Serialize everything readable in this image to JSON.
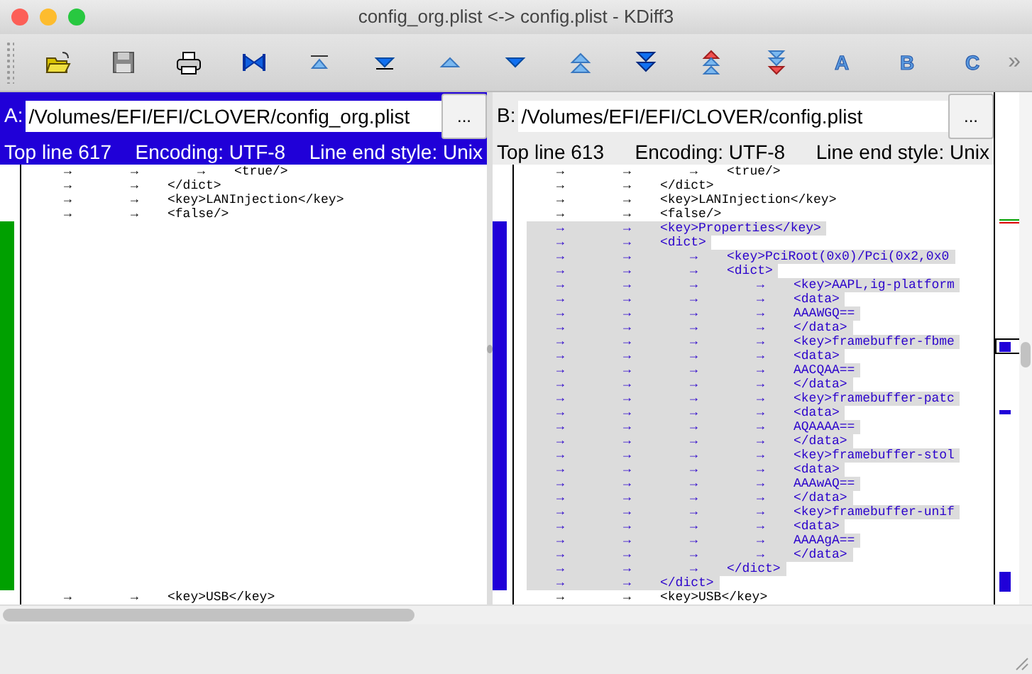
{
  "window": {
    "title": "config_org.plist <-> config.plist - KDiff3"
  },
  "toolbar": {
    "letters": [
      "A",
      "B",
      "C"
    ],
    "overflow": "»"
  },
  "panes": [
    {
      "label": "A:",
      "path": "/Volumes/EFI/EFI/CLOVER/config_org.plist",
      "browse": "...",
      "active": true,
      "top_line": "Top line 617",
      "encoding": "Encoding: UTF-8",
      "line_end": "Line end style: Unix",
      "lines": [
        {
          "kind": "same",
          "tabs": [
            "→",
            "→",
            "→"
          ],
          "text": "<true/>"
        },
        {
          "kind": "same",
          "tabs": [
            "→",
            "→"
          ],
          "text": "</dict>"
        },
        {
          "kind": "same",
          "tabs": [
            "→",
            "→"
          ],
          "text": "<key>LANInjection</key>"
        },
        {
          "kind": "same",
          "tabs": [
            "→",
            "→"
          ],
          "text": "<false/>"
        },
        {
          "kind": "blank"
        },
        {
          "kind": "blank"
        },
        {
          "kind": "blank"
        },
        {
          "kind": "blank"
        },
        {
          "kind": "blank"
        },
        {
          "kind": "blank"
        },
        {
          "kind": "blank"
        },
        {
          "kind": "blank"
        },
        {
          "kind": "blank"
        },
        {
          "kind": "blank"
        },
        {
          "kind": "blank"
        },
        {
          "kind": "blank"
        },
        {
          "kind": "blank"
        },
        {
          "kind": "blank"
        },
        {
          "kind": "blank"
        },
        {
          "kind": "blank"
        },
        {
          "kind": "blank"
        },
        {
          "kind": "blank"
        },
        {
          "kind": "blank"
        },
        {
          "kind": "blank"
        },
        {
          "kind": "blank"
        },
        {
          "kind": "blank"
        },
        {
          "kind": "blank"
        },
        {
          "kind": "blank"
        },
        {
          "kind": "blank"
        },
        {
          "kind": "blank"
        },
        {
          "kind": "same",
          "tabs": [
            "→",
            "→"
          ],
          "text": "<key>USB</key>"
        }
      ]
    },
    {
      "label": "B:",
      "path": "/Volumes/EFI/EFI/CLOVER/config.plist",
      "browse": "...",
      "active": false,
      "top_line": "Top line 613",
      "encoding": "Encoding: UTF-8",
      "line_end": "Line end style: Unix",
      "lines": [
        {
          "kind": "same",
          "tabs": [
            "→",
            "→",
            "→"
          ],
          "text": "<true/>"
        },
        {
          "kind": "same",
          "tabs": [
            "→",
            "→"
          ],
          "text": "</dict>"
        },
        {
          "kind": "same",
          "tabs": [
            "→",
            "→"
          ],
          "text": "<key>LANInjection</key>"
        },
        {
          "kind": "same",
          "tabs": [
            "→",
            "→"
          ],
          "text": "<false/>"
        },
        {
          "kind": "added",
          "tabs": [
            "→",
            "→"
          ],
          "text": "<key>Properties</key>"
        },
        {
          "kind": "added",
          "tabs": [
            "→",
            "→"
          ],
          "text": "<dict>"
        },
        {
          "kind": "added",
          "tabs": [
            "→",
            "→",
            "→"
          ],
          "text": "<key>PciRoot(0x0)/Pci(0x2,0x0"
        },
        {
          "kind": "added",
          "tabs": [
            "→",
            "→",
            "→"
          ],
          "text": "<dict>"
        },
        {
          "kind": "added",
          "tabs": [
            "→",
            "→",
            "→",
            "→"
          ],
          "text": "<key>AAPL,ig-platform"
        },
        {
          "kind": "added",
          "tabs": [
            "→",
            "→",
            "→",
            "→"
          ],
          "text": "<data>"
        },
        {
          "kind": "added",
          "tabs": [
            "→",
            "→",
            "→",
            "→"
          ],
          "text": "AAAWGQ=="
        },
        {
          "kind": "added",
          "tabs": [
            "→",
            "→",
            "→",
            "→"
          ],
          "text": "</data>"
        },
        {
          "kind": "added",
          "tabs": [
            "→",
            "→",
            "→",
            "→"
          ],
          "text": "<key>framebuffer-fbme"
        },
        {
          "kind": "added",
          "tabs": [
            "→",
            "→",
            "→",
            "→"
          ],
          "text": "<data>"
        },
        {
          "kind": "added",
          "tabs": [
            "→",
            "→",
            "→",
            "→"
          ],
          "text": "AACQAA=="
        },
        {
          "kind": "added",
          "tabs": [
            "→",
            "→",
            "→",
            "→"
          ],
          "text": "</data>"
        },
        {
          "kind": "added",
          "tabs": [
            "→",
            "→",
            "→",
            "→"
          ],
          "text": "<key>framebuffer-patc"
        },
        {
          "kind": "added",
          "tabs": [
            "→",
            "→",
            "→",
            "→"
          ],
          "text": "<data>"
        },
        {
          "kind": "added",
          "tabs": [
            "→",
            "→",
            "→",
            "→"
          ],
          "text": "AQAAAA=="
        },
        {
          "kind": "added",
          "tabs": [
            "→",
            "→",
            "→",
            "→"
          ],
          "text": "</data>"
        },
        {
          "kind": "added",
          "tabs": [
            "→",
            "→",
            "→",
            "→"
          ],
          "text": "<key>framebuffer-stol"
        },
        {
          "kind": "added",
          "tabs": [
            "→",
            "→",
            "→",
            "→"
          ],
          "text": "<data>"
        },
        {
          "kind": "added",
          "tabs": [
            "→",
            "→",
            "→",
            "→"
          ],
          "text": "AAAwAQ=="
        },
        {
          "kind": "added",
          "tabs": [
            "→",
            "→",
            "→",
            "→"
          ],
          "text": "</data>"
        },
        {
          "kind": "added",
          "tabs": [
            "→",
            "→",
            "→",
            "→"
          ],
          "text": "<key>framebuffer-unif"
        },
        {
          "kind": "added",
          "tabs": [
            "→",
            "→",
            "→",
            "→"
          ],
          "text": "<data>"
        },
        {
          "kind": "added",
          "tabs": [
            "→",
            "→",
            "→",
            "→"
          ],
          "text": "AAAAgA=="
        },
        {
          "kind": "added",
          "tabs": [
            "→",
            "→",
            "→",
            "→"
          ],
          "text": "</data>"
        },
        {
          "kind": "added",
          "tabs": [
            "→",
            "→",
            "→"
          ],
          "text": "</dict>"
        },
        {
          "kind": "added",
          "tabs": [
            "→",
            "→"
          ],
          "text": "</dict>"
        },
        {
          "kind": "same",
          "tabs": [
            "→",
            "→"
          ],
          "text": "<key>USB</key>"
        }
      ]
    }
  ]
}
